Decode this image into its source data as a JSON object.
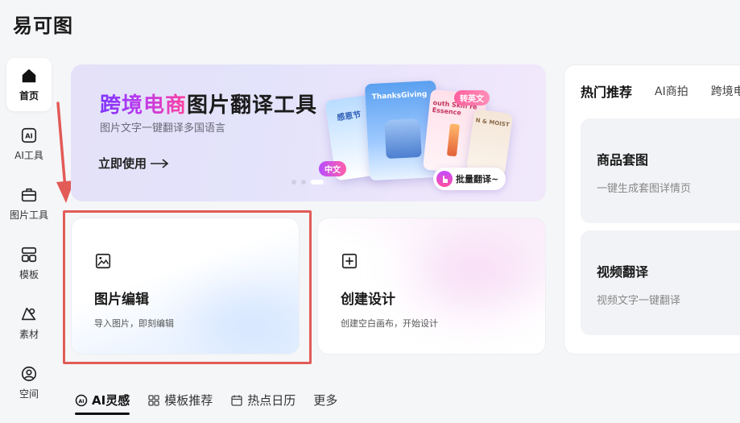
{
  "app": {
    "logo": "易可图"
  },
  "sidebar": {
    "items": [
      {
        "label": "首页",
        "icon": "home-icon",
        "active": true
      },
      {
        "label": "AI工具",
        "icon": "ai-icon"
      },
      {
        "label": "图片工具",
        "icon": "toolbox-icon"
      },
      {
        "label": "模板",
        "icon": "template-icon"
      },
      {
        "label": "素材",
        "icon": "material-icon"
      },
      {
        "label": "空间",
        "icon": "user-space-icon"
      }
    ]
  },
  "banner": {
    "title_highlight": "跨境电商",
    "title_rest": "图片翻译工具",
    "subtitle": "图片文字一键翻译多国语言",
    "cta": "立即使用",
    "slide_count": 3,
    "active_slide": 3,
    "illustration": {
      "card_left_text": "感恩节",
      "card_main_text": "ThanksGiving",
      "card_right_text": "outh Skin re Essence",
      "card_far_text": "N & MOIST",
      "tag_cn": "中文",
      "tag_en": "转英文",
      "batch_label": "批量翻译~"
    }
  },
  "actions": [
    {
      "title": "图片编辑",
      "subtitle": "导入图片，即刻编辑",
      "icon": "image-edit-icon"
    },
    {
      "title": "创建设计",
      "subtitle": "创建空白画布，开始设计",
      "icon": "plus-square-icon"
    }
  ],
  "bottom_tabs": [
    {
      "label": "AI灵感",
      "icon": "ai-spark-icon",
      "active": true
    },
    {
      "label": "模板推荐",
      "icon": "grid-icon"
    },
    {
      "label": "热点日历",
      "icon": "calendar-icon"
    },
    {
      "label": "更多"
    }
  ],
  "right_panel": {
    "tabs": [
      {
        "label": "热门推荐",
        "active": true
      },
      {
        "label": "AI商拍"
      },
      {
        "label": "跨境电"
      }
    ],
    "cards": [
      {
        "title": "商品套图",
        "subtitle": "一键生成套图详情页"
      },
      {
        "title": "视频翻译",
        "subtitle": "视频文字一键翻译"
      }
    ]
  },
  "annotation": {
    "arrow_color": "#e25b57",
    "box_color": "#e25b57"
  }
}
